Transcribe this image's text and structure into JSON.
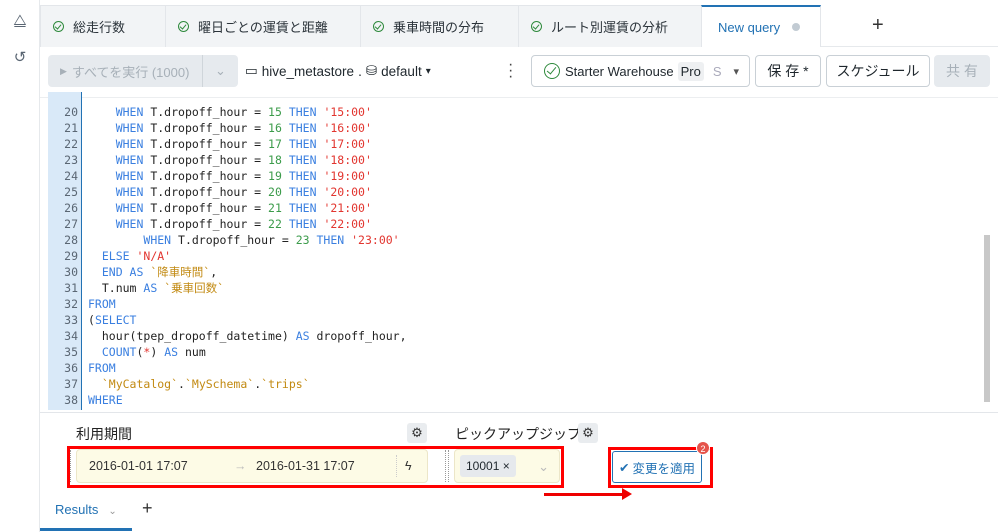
{
  "rail": {
    "icons": [
      "shapes-icon",
      "history-icon"
    ]
  },
  "tabs": [
    {
      "label": "総走行数",
      "status": "check"
    },
    {
      "label": "曜日ごとの運賃と距離",
      "status": "check"
    },
    {
      "label": "乗車時間の分布",
      "status": "check"
    },
    {
      "label": "ルート別運賃の分析",
      "status": "check"
    },
    {
      "label": "New query",
      "status": "unsaved",
      "active": true
    }
  ],
  "add_tab": "+",
  "toolbar": {
    "run_label": "すべてを実行 (1000)",
    "catalog": "hive_metastore",
    "sep": ".",
    "schema": "default",
    "warehouse": "Starter Warehouse",
    "warehouse_tier": "Pro",
    "warehouse_size": "S",
    "save": "保 存 *",
    "schedule": "スケジュール",
    "share": "共 有"
  },
  "editor": {
    "lines": [
      {
        "n": "20",
        "i": "    ",
        "t": [
          [
            "k",
            "WHEN "
          ],
          [
            "t",
            "T.dropoff_hour = "
          ],
          [
            "n",
            "15"
          ],
          [
            "k",
            " THEN "
          ],
          [
            "s2",
            "'15:00'"
          ]
        ]
      },
      {
        "n": "21",
        "i": "    ",
        "t": [
          [
            "k",
            "WHEN "
          ],
          [
            "t",
            "T.dropoff_hour = "
          ],
          [
            "n",
            "16"
          ],
          [
            "k",
            " THEN "
          ],
          [
            "s2",
            "'16:00'"
          ]
        ]
      },
      {
        "n": "22",
        "i": "    ",
        "t": [
          [
            "k",
            "WHEN "
          ],
          [
            "t",
            "T.dropoff_hour = "
          ],
          [
            "n",
            "17"
          ],
          [
            "k",
            " THEN "
          ],
          [
            "s2",
            "'17:00'"
          ]
        ]
      },
      {
        "n": "23",
        "i": "    ",
        "t": [
          [
            "k",
            "WHEN "
          ],
          [
            "t",
            "T.dropoff_hour = "
          ],
          [
            "n",
            "18"
          ],
          [
            "k",
            " THEN "
          ],
          [
            "s2",
            "'18:00'"
          ]
        ]
      },
      {
        "n": "24",
        "i": "    ",
        "t": [
          [
            "k",
            "WHEN "
          ],
          [
            "t",
            "T.dropoff_hour = "
          ],
          [
            "n",
            "19"
          ],
          [
            "k",
            " THEN "
          ],
          [
            "s2",
            "'19:00'"
          ]
        ]
      },
      {
        "n": "25",
        "i": "    ",
        "t": [
          [
            "k",
            "WHEN "
          ],
          [
            "t",
            "T.dropoff_hour = "
          ],
          [
            "n",
            "20"
          ],
          [
            "k",
            " THEN "
          ],
          [
            "s2",
            "'20:00'"
          ]
        ]
      },
      {
        "n": "26",
        "i": "    ",
        "t": [
          [
            "k",
            "WHEN "
          ],
          [
            "t",
            "T.dropoff_hour = "
          ],
          [
            "n",
            "21"
          ],
          [
            "k",
            " THEN "
          ],
          [
            "s2",
            "'21:00'"
          ]
        ]
      },
      {
        "n": "27",
        "i": "    ",
        "t": [
          [
            "k",
            "WHEN "
          ],
          [
            "t",
            "T.dropoff_hour = "
          ],
          [
            "n",
            "22"
          ],
          [
            "k",
            " THEN "
          ],
          [
            "s2",
            "'22:00'"
          ]
        ]
      },
      {
        "n": "28",
        "i": "        ",
        "t": [
          [
            "k",
            "WHEN "
          ],
          [
            "t",
            "T.dropoff_hour = "
          ],
          [
            "n",
            "23"
          ],
          [
            "k",
            " THEN "
          ],
          [
            "s2",
            "'23:00'"
          ]
        ]
      },
      {
        "n": "29",
        "i": "  ",
        "t": [
          [
            "k",
            "ELSE "
          ],
          [
            "s2",
            "'N/A'"
          ]
        ]
      },
      {
        "n": "30",
        "i": "  ",
        "t": [
          [
            "k",
            "END AS "
          ],
          [
            "b",
            "`降車時間`"
          ],
          [
            "t",
            ","
          ]
        ]
      },
      {
        "n": "31",
        "i": "  ",
        "t": [
          [
            "t",
            "T.num "
          ],
          [
            "k",
            "AS "
          ],
          [
            "b",
            "`乗車回数`"
          ]
        ]
      },
      {
        "n": "32",
        "i": "",
        "t": [
          [
            "k",
            "FROM"
          ]
        ]
      },
      {
        "n": "33",
        "i": "",
        "t": [
          [
            "t",
            "("
          ],
          [
            "k",
            "SELECT"
          ]
        ]
      },
      {
        "n": "34",
        "i": "  ",
        "t": [
          [
            "t",
            "hour(tpep_dropoff_datetime) "
          ],
          [
            "k",
            "AS "
          ],
          [
            "t",
            "dropoff_hour,"
          ]
        ]
      },
      {
        "n": "35",
        "i": "  ",
        "t": [
          [
            "k",
            "COUNT"
          ],
          [
            "t",
            "("
          ],
          [
            "s2",
            "*"
          ],
          [
            "t",
            ") "
          ],
          [
            "k",
            "AS "
          ],
          [
            "t",
            "num"
          ]
        ]
      },
      {
        "n": "36",
        "i": "",
        "t": [
          [
            "k",
            "FROM"
          ]
        ]
      },
      {
        "n": "37",
        "i": "  ",
        "t": [
          [
            "b",
            "`MyCatalog`"
          ],
          [
            "t",
            "."
          ],
          [
            "b",
            "`MySchema`"
          ],
          [
            "t",
            "."
          ],
          [
            "b",
            "`trips`"
          ]
        ]
      },
      {
        "n": "38",
        "i": "",
        "t": [
          [
            "k",
            "WHERE"
          ]
        ]
      }
    ]
  },
  "params": {
    "period_label": "利用期間",
    "start": "2016-01-01 17:07",
    "arrow": "→",
    "end": "2016-01-31 17:07",
    "zip_label": "ピックアップジップ",
    "zip_value": "10001 ×",
    "apply": "変更を適用",
    "badge": "2"
  },
  "results": {
    "tab": "Results",
    "add": "+"
  }
}
